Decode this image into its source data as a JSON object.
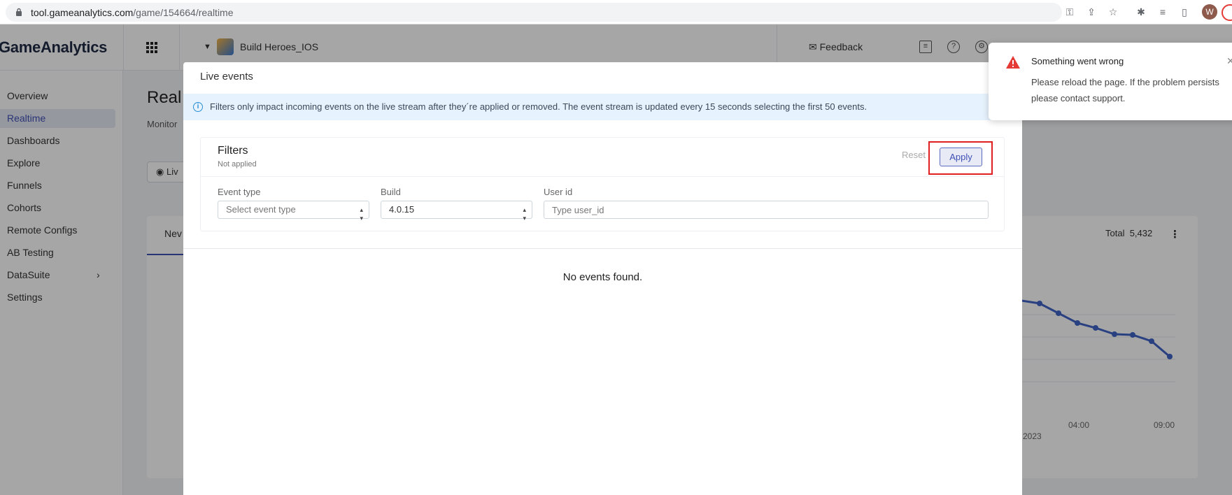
{
  "browser": {
    "url_host": "tool.gameanalytics.com",
    "url_path": "/game/154664/realtime",
    "profile_initial": "W"
  },
  "app": {
    "logo": "GameAnalytics",
    "game_name": "Build Heroes_IOS",
    "feedback_label": "Feedback"
  },
  "sidebar": {
    "items": [
      {
        "label": "Overview"
      },
      {
        "label": "Realtime",
        "active": true
      },
      {
        "label": "Dashboards"
      },
      {
        "label": "Explore"
      },
      {
        "label": "Funnels"
      },
      {
        "label": "Cohorts"
      },
      {
        "label": "Remote Configs"
      },
      {
        "label": "AB Testing"
      },
      {
        "label": "DataSuite",
        "has_children": true
      },
      {
        "label": "Settings"
      }
    ]
  },
  "page": {
    "title": "Real",
    "subtitle": "Monitor",
    "live_chip": "Liv",
    "card_tab": "Nev",
    "total_label": "Total",
    "total_value": "5,432",
    "x_ticks": [
      "04:00",
      "09:00"
    ],
    "x_year_fragment": "2023"
  },
  "modal": {
    "title": "Live events",
    "info_text": "Filters only impact incoming events on the live stream after they´re applied or removed. The event stream is updated every 15 seconds selecting the first 50 events.",
    "filters": {
      "title": "Filters",
      "status": "Not applied",
      "reset_label": "Reset",
      "apply_label": "Apply",
      "event_type_label": "Event type",
      "event_type_placeholder": "Select event type",
      "build_label": "Build",
      "build_value": "4.0.15",
      "user_id_label": "User id",
      "user_id_placeholder": "Type user_id"
    },
    "empty_text": "No events found."
  },
  "toast": {
    "title": "Something went wrong",
    "line1": "Please reload the page. If the problem persists",
    "line2": "please contact support."
  },
  "colors": {
    "accent": "#3f51b5",
    "highlight": "#e02020",
    "info_bg": "#e6f2fd",
    "warning": "#e53935"
  }
}
